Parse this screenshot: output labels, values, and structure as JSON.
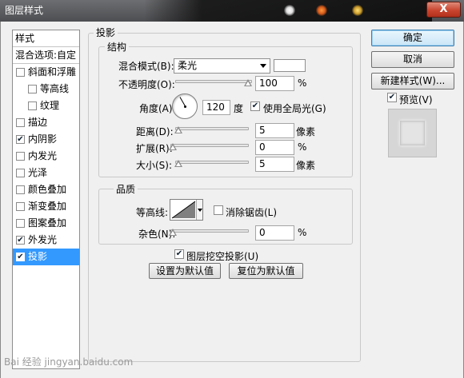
{
  "window": {
    "title": "图层样式",
    "close_label": "X"
  },
  "style_list": {
    "header": "样式",
    "blend_options": "混合选项:自定",
    "items": [
      {
        "label": "斜面和浮雕",
        "checked": false,
        "indent": false
      },
      {
        "label": "等高线",
        "checked": false,
        "indent": true
      },
      {
        "label": "纹理",
        "checked": false,
        "indent": true
      },
      {
        "label": "描边",
        "checked": false,
        "indent": false
      },
      {
        "label": "内阴影",
        "checked": true,
        "indent": false
      },
      {
        "label": "内发光",
        "checked": false,
        "indent": false
      },
      {
        "label": "光泽",
        "checked": false,
        "indent": false
      },
      {
        "label": "颜色叠加",
        "checked": false,
        "indent": false
      },
      {
        "label": "渐变叠加",
        "checked": false,
        "indent": false
      },
      {
        "label": "图案叠加",
        "checked": false,
        "indent": false
      },
      {
        "label": "外发光",
        "checked": true,
        "indent": false
      },
      {
        "label": "投影",
        "checked": true,
        "indent": false,
        "selected": true
      }
    ]
  },
  "panel": {
    "title": "投影",
    "structure": {
      "legend": "结构",
      "blend_mode_label": "混合模式(B):",
      "blend_mode_value": "柔光",
      "opacity_label": "不透明度(O):",
      "opacity_value": "100",
      "opacity_unit": "%",
      "opacity_level": 0.95,
      "angle_label": "角度(A):",
      "angle_value": "120",
      "angle_unit": "度",
      "global_light_label": "使用全局光(G)",
      "distance_label": "距离(D):",
      "distance_value": "5",
      "distance_unit": "像素",
      "spread_label": "扩展(R):",
      "spread_value": "0",
      "spread_unit": "%",
      "size_label": "大小(S):",
      "size_value": "5",
      "size_unit": "像素"
    },
    "quality": {
      "legend": "品质",
      "contour_label": "等高线:",
      "antialias_label": "消除锯齿(L)",
      "noise_label": "杂色(N):",
      "noise_value": "0",
      "noise_unit": "%"
    },
    "knockout_label": "图层挖空投影(U)",
    "make_default": "设置为默认值",
    "reset_default": "复位为默认值"
  },
  "buttons": {
    "ok": "确定",
    "cancel": "取消",
    "new_style": "新建样式(W)...",
    "preview_label": "预览(V)"
  },
  "watermark": "Bai 经验 jingyan.baidu.com",
  "colors": {
    "selection": "#3399ff",
    "dialog_bg": "#f0f0f0",
    "titlebar": "#5d5e61"
  }
}
